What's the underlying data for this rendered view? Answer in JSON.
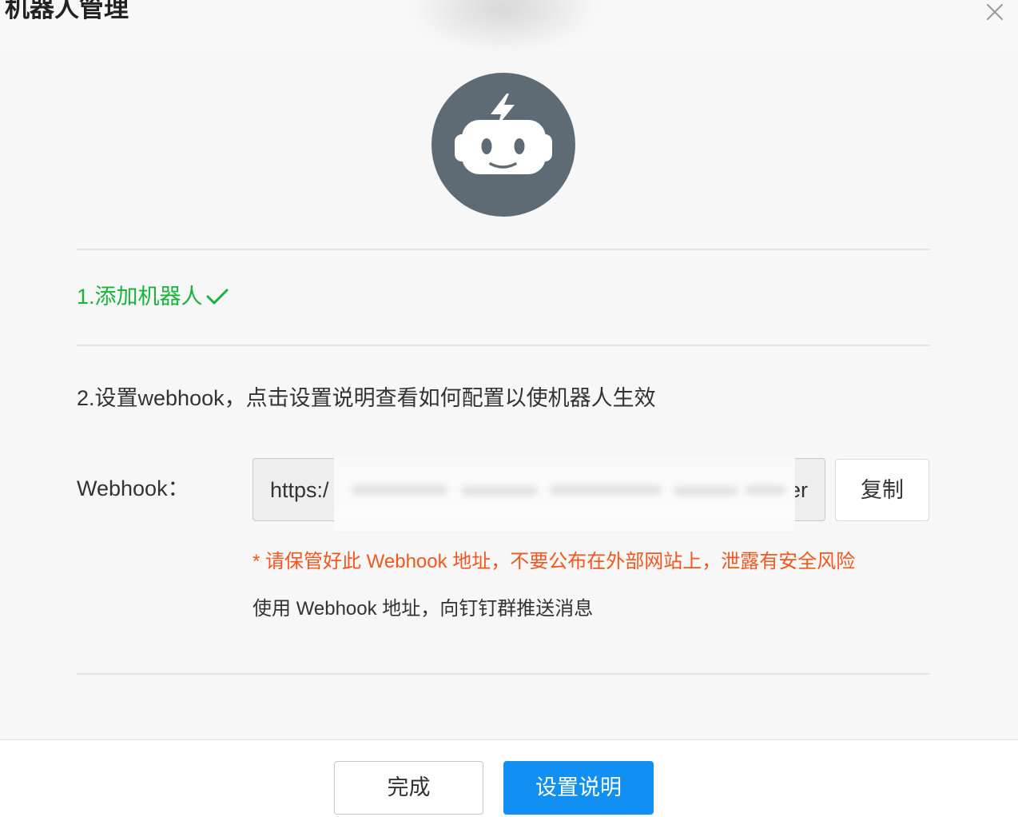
{
  "dialog": {
    "title": "机器人管理",
    "close_icon": "close-icon"
  },
  "robot": {
    "icon": "robot-avatar-icon"
  },
  "steps": {
    "step1_label": "1.添加机器人",
    "step1_icon": "check-icon",
    "step2_label": "2.设置webhook，点击设置说明查看如何配置以使机器人生效"
  },
  "webhook": {
    "label": "Webhook：",
    "value_start": "https:/",
    "value_end": "er",
    "copy_label": "复制",
    "warning": "* 请保管好此 Webhook 地址，不要公布在外部网站上，泄露有安全风险",
    "usage": "使用 Webhook 地址，向钉钉群推送消息"
  },
  "footer": {
    "done_label": "完成",
    "help_label": "设置说明"
  },
  "colors": {
    "success": "#18b33c",
    "warning": "#f4561e",
    "primary": "#118ff3",
    "avatar": "#5f6b74"
  }
}
